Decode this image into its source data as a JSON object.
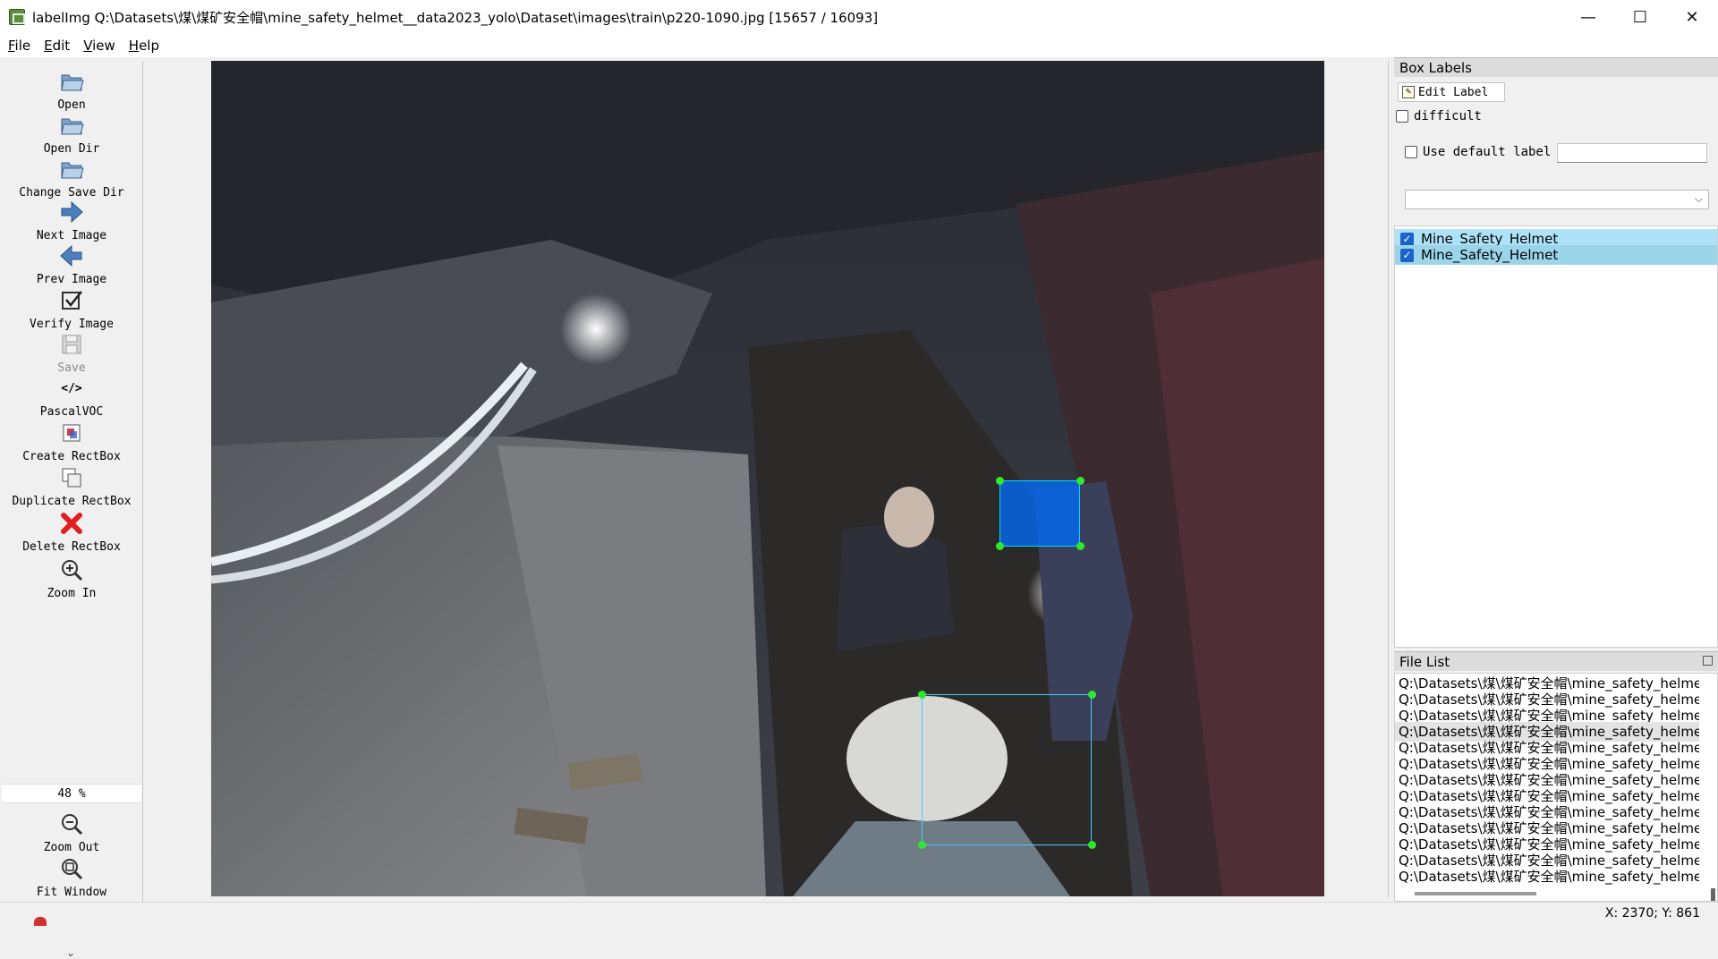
{
  "window": {
    "title": "labelImg Q:\\Datasets\\煤\\煤矿安全帽\\mine_safety_helmet__data2023_yolo\\Dataset\\images\\train\\p220-1090.jpg [15657 / 16093]",
    "minimize": "—",
    "maximize": "☐",
    "close": "✕"
  },
  "menu": [
    {
      "key": "F",
      "rest": "ile"
    },
    {
      "key": "E",
      "rest": "dit"
    },
    {
      "key": "V",
      "rest": "iew"
    },
    {
      "key": "H",
      "rest": "elp"
    }
  ],
  "toolbar": {
    "open": "Open",
    "open_dir": "Open Dir",
    "change_save_dir": "Change Save Dir",
    "next_image": "Next Image",
    "prev_image": "Prev Image",
    "verify_image": "Verify Image",
    "save": "Save",
    "format": "PascalVOC",
    "create_rectbox": "Create RectBox",
    "duplicate_rectbox": "Duplicate RectBox",
    "delete_rectbox": "Delete RectBox",
    "zoom_in": "Zoom In",
    "zoom_value": "48 %",
    "zoom_out": "Zoom Out",
    "fit_window": "Fit Window"
  },
  "box_labels": {
    "title": "Box Labels",
    "edit_label": "Edit Label",
    "difficult": "difficult",
    "use_default_label": "Use default label",
    "default_label_value": "",
    "items": [
      "Mine_Safety_Helmet",
      "Mine_Safety_Helmet"
    ]
  },
  "file_list": {
    "title": "File List",
    "items": [
      "Q:\\Datasets\\煤\\煤矿安全帽\\mine_safety_helmet",
      "Q:\\Datasets\\煤\\煤矿安全帽\\mine_safety_helmet",
      "Q:\\Datasets\\煤\\煤矿安全帽\\mine_safety_helmet",
      "Q:\\Datasets\\煤\\煤矿安全帽\\mine_safety_helmet",
      "Q:\\Datasets\\煤\\煤矿安全帽\\mine_safety_helmet",
      "Q:\\Datasets\\煤\\煤矿安全帽\\mine_safety_helmet",
      "Q:\\Datasets\\煤\\煤矿安全帽\\mine_safety_helmet",
      "Q:\\Datasets\\煤\\煤矿安全帽\\mine_safety_helmet",
      "Q:\\Datasets\\煤\\煤矿安全帽\\mine_safety_helmet",
      "Q:\\Datasets\\煤\\煤矿安全帽\\mine_safety_helmet",
      "Q:\\Datasets\\煤\\煤矿安全帽\\mine_safety_helmet",
      "Q:\\Datasets\\煤\\煤矿安全帽\\mine_safety_helmet",
      "Q:\\Datasets\\煤\\煤矿安全帽\\mine_safety_helmet"
    ]
  },
  "status": {
    "coords": "X: 2370; Y: 861"
  },
  "colors": {
    "selected_box_fill": "#006eff",
    "box_handle": "#2ee82e",
    "label_selected_bg": "#aee3f7",
    "label_bg": "#9ad5ea"
  }
}
